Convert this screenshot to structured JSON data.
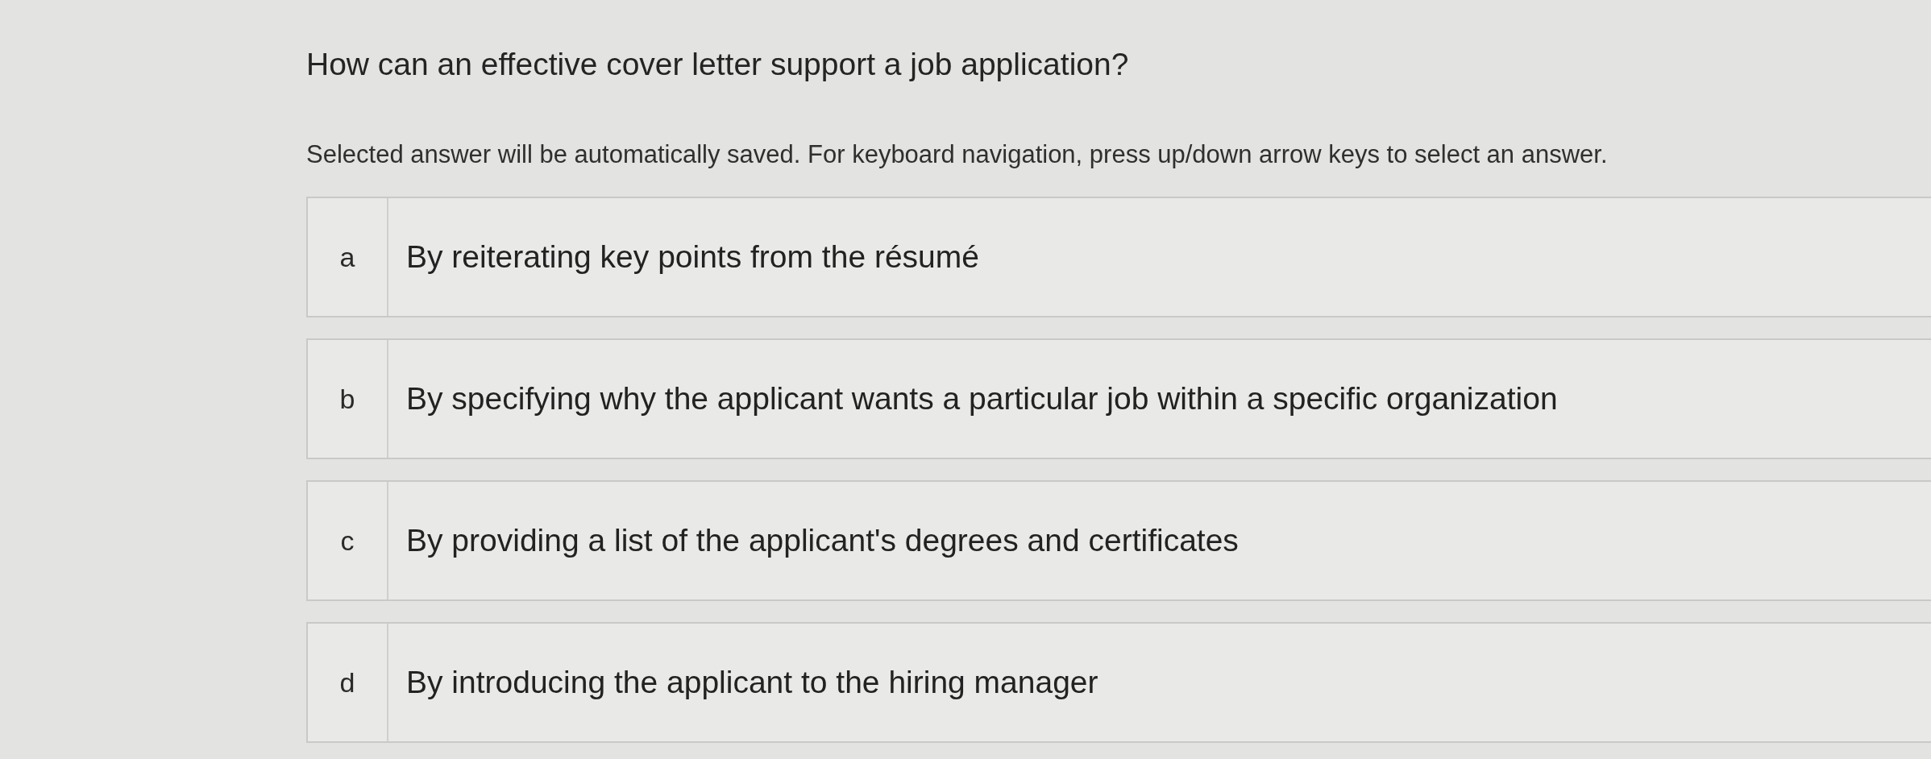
{
  "question": "How can an effective cover letter support a job application?",
  "instructions": "Selected answer will be automatically saved. For keyboard navigation, press up/down arrow keys to select an answer.",
  "options": [
    {
      "letter": "a",
      "text": "By reiterating key points from the résumé",
      "selected": false
    },
    {
      "letter": "b",
      "text": "By specifying why the applicant wants a particular job within a specific organization",
      "selected": false
    },
    {
      "letter": "c",
      "text": "By providing a list of the applicant's degrees and certificates",
      "selected": false
    },
    {
      "letter": "d",
      "text": "By introducing the applicant to the hiring manager",
      "selected": false
    }
  ]
}
